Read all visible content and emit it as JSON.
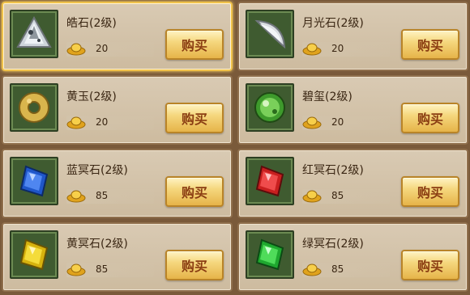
{
  "shop": {
    "items": [
      {
        "name": "皓石(2级)",
        "price": "20",
        "buy_label": "购买",
        "icon": "white-gem-icon",
        "selected": true
      },
      {
        "name": "月光石(2级)",
        "price": "20",
        "buy_label": "购买",
        "icon": "moonstone-icon"
      },
      {
        "name": "黄玉(2级)",
        "price": "20",
        "buy_label": "购买",
        "icon": "jade-ring-icon"
      },
      {
        "name": "碧玺(2级)",
        "price": "20",
        "buy_label": "购买",
        "icon": "green-orb-icon"
      },
      {
        "name": "蓝冥石(2级)",
        "price": "85",
        "buy_label": "购买",
        "icon": "blue-crystal-icon"
      },
      {
        "name": "红冥石(2级)",
        "price": "85",
        "buy_label": "购买",
        "icon": "red-crystal-icon"
      },
      {
        "name": "黄冥石(2级)",
        "price": "85",
        "buy_label": "购买",
        "icon": "yellow-crystal-icon"
      },
      {
        "name": "绿冥石(2级)",
        "price": "85",
        "buy_label": "购买",
        "icon": "green-crystal-icon"
      }
    ],
    "currency_icon": "gold-ingot-icon"
  }
}
